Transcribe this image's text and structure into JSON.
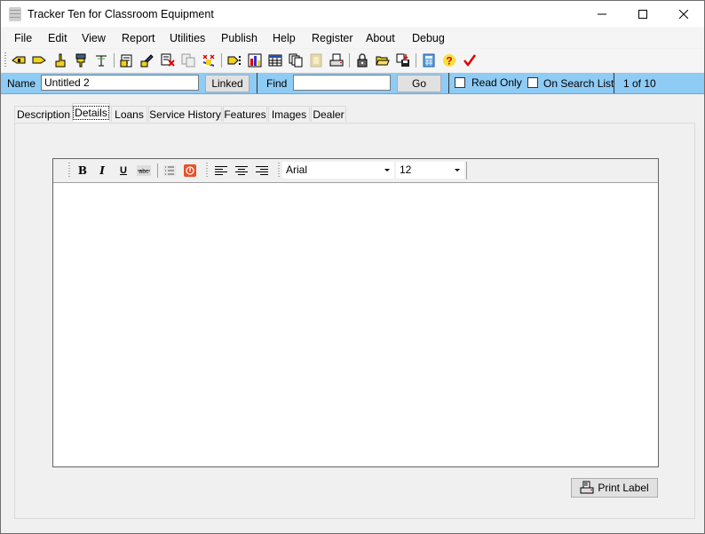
{
  "window": {
    "title": "Tracker Ten for Classroom Equipment",
    "controls": [
      "minimize",
      "maximize",
      "close"
    ]
  },
  "menu": [
    "File",
    "Edit",
    "View",
    "Report",
    "Utilities",
    "Publish",
    "Help",
    "Register",
    "About",
    "Debug"
  ],
  "toolbar": {
    "icons": [
      "first-record",
      "next-record",
      "pointer-up",
      "pointer-down",
      "filter",
      "edit-record",
      "edit-pencil",
      "delete-record",
      "copy-record",
      "clear-record",
      "go-to",
      "chart",
      "table",
      "copy-documents",
      "film",
      "print",
      "lock",
      "open-folder",
      "save-as",
      "calculator",
      "help",
      "check"
    ]
  },
  "infobar": {
    "name_label": "Name",
    "name_value": "Untitled 2",
    "linked_label": "Linked",
    "find_label": "Find",
    "find_value": "",
    "go_label": "Go",
    "read_only_label": "Read Only",
    "read_only_checked": false,
    "on_search_list_label": "On Search List",
    "on_search_list_checked": false,
    "record_position": "1 of 10"
  },
  "tabs": [
    {
      "label": "Description",
      "active": false
    },
    {
      "label": "Details",
      "active": true
    },
    {
      "label": "Loans",
      "active": false
    },
    {
      "label": "Service History",
      "active": false
    },
    {
      "label": "Features",
      "active": false
    },
    {
      "label": "Images",
      "active": false
    },
    {
      "label": "Dealer",
      "active": false
    }
  ],
  "editor": {
    "font": "Arial",
    "size": "12",
    "content": "",
    "buttons": [
      "bold",
      "italic",
      "underline",
      "strikethrough",
      "bullet-list",
      "numbered-list",
      "align-left",
      "align-center",
      "align-right"
    ]
  },
  "print_label_button": "Print Label"
}
